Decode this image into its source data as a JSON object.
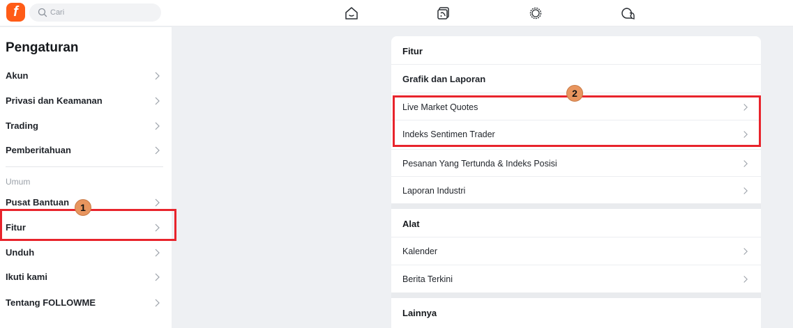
{
  "topbar": {
    "logo_letter": "f",
    "search_placeholder": "Cari",
    "nav_icons": [
      "home-icon",
      "feed-icon",
      "gear-icon",
      "chat-icon"
    ]
  },
  "sidebar": {
    "title": "Pengaturan",
    "group1": [
      {
        "label": "Akun"
      },
      {
        "label": "Privasi dan Keamanan"
      },
      {
        "label": "Trading"
      },
      {
        "label": "Pemberitahuan"
      }
    ],
    "section_label": "Umum",
    "group2": [
      {
        "label": "Pusat Bantuan"
      },
      {
        "label": "Fitur"
      },
      {
        "label": "Unduh"
      },
      {
        "label": "Ikuti kami"
      },
      {
        "label": "Tentang FOLLOWME"
      }
    ]
  },
  "panel": {
    "fitur": {
      "title": "Fitur",
      "items": [
        {
          "label": "Grafik dan Laporan"
        },
        {
          "label": "Live Market Quotes"
        },
        {
          "label": "Indeks Sentimen Trader"
        },
        {
          "label": "Pesanan Yang Tertunda & Indeks Posisi"
        },
        {
          "label": "Laporan Industri"
        }
      ]
    },
    "alat": {
      "title": "Alat",
      "items": [
        {
          "label": "Kalender"
        },
        {
          "label": "Berita Terkini"
        }
      ]
    },
    "lainnya": {
      "title": "Lainnya"
    }
  },
  "annotations": {
    "step1": "1",
    "step2": "2",
    "highlight_color": "#e8242c",
    "badge_color": "#e8955e"
  },
  "colors": {
    "brand": "#ff5c17",
    "background": "#eef0f3"
  }
}
